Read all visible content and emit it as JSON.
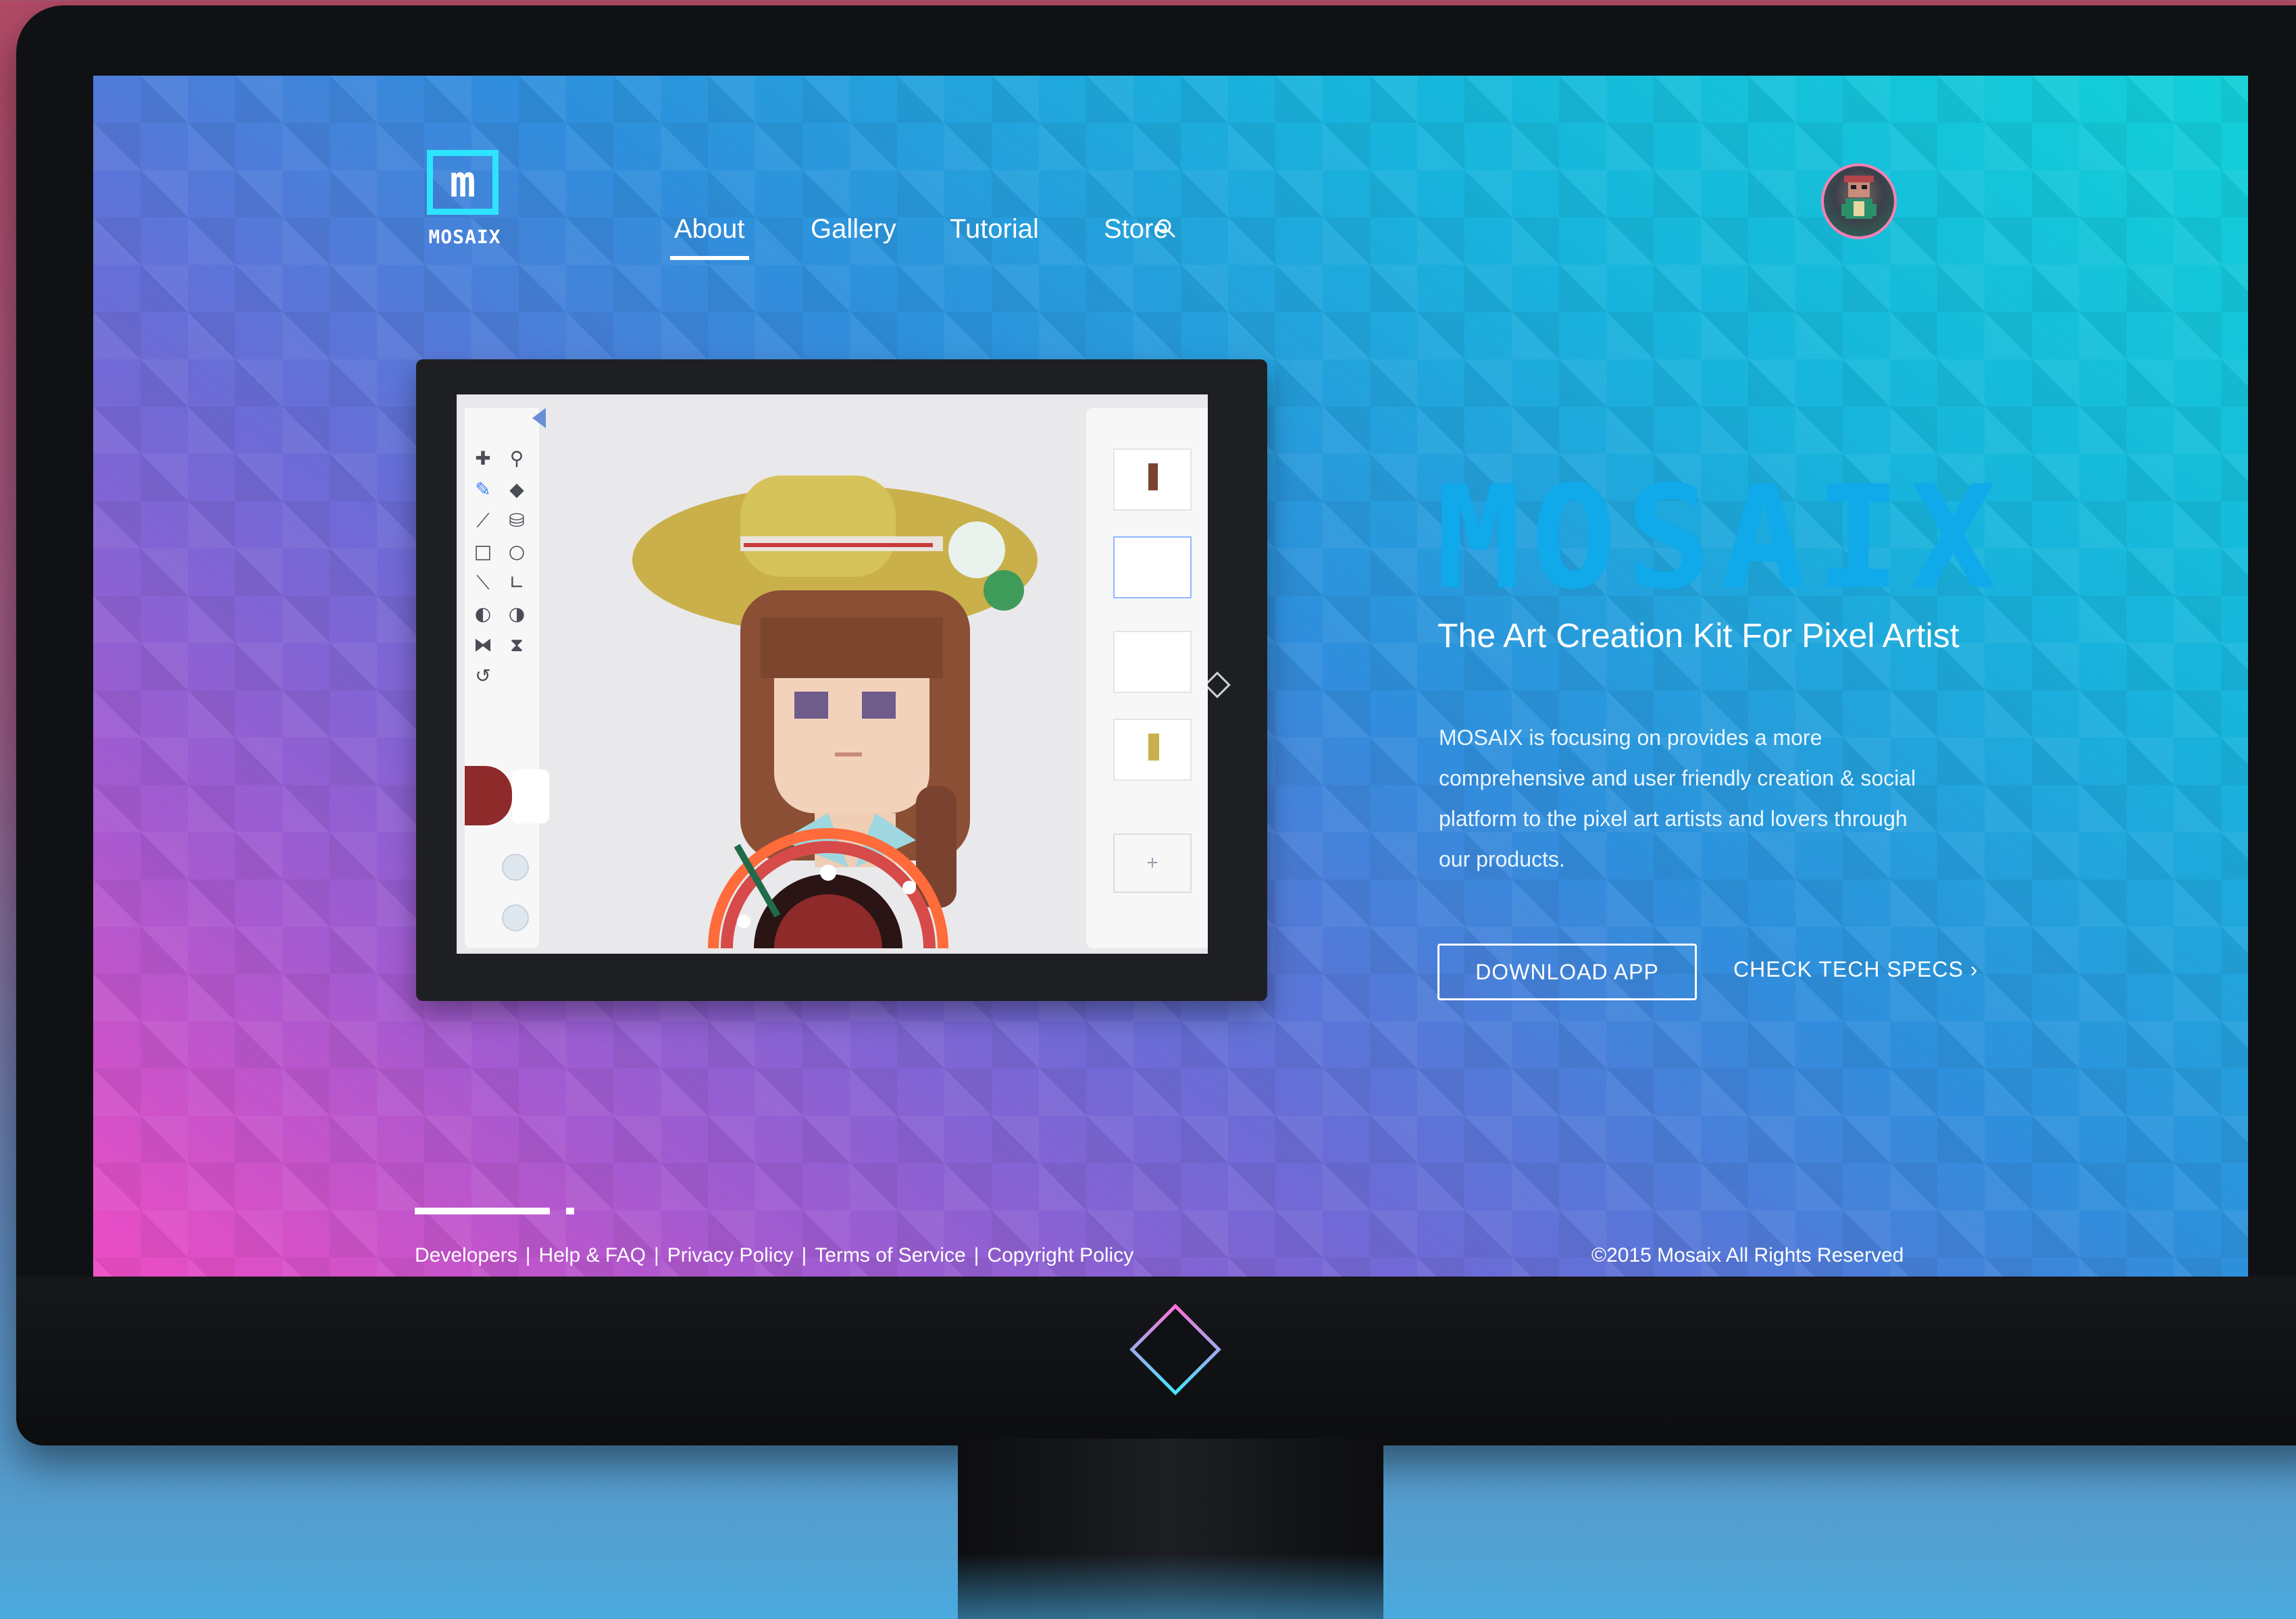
{
  "brand": {
    "logo_mark": "m",
    "logo_text": "MOSAIX",
    "name": "MOSAIX"
  },
  "nav": {
    "items": [
      {
        "label": "About",
        "active": true
      },
      {
        "label": "Gallery",
        "active": false
      },
      {
        "label": "Tutorial",
        "active": false
      },
      {
        "label": "Store",
        "active": false
      }
    ],
    "search_icon": "search-icon"
  },
  "hero": {
    "tagline": "The Art Creation Kit For Pixel Artist",
    "description": "MOSAIX is focusing on provides a more comprehensive and user friendly creation & social platform to the pixel art artists and lovers through our products.",
    "primary_button": "DOWNLOAD APP",
    "secondary_link": "CHECK TECH SPECS ›"
  },
  "app_mock": {
    "add_layer": "+"
  },
  "footer": {
    "links": [
      "Developers",
      "Help & FAQ",
      "Privacy Policy",
      "Terms of Service",
      "Copyright Policy"
    ],
    "separator": "|",
    "copyright": "©2015 Mosaix All Rights Reserved"
  },
  "colors": {
    "accent": "#2de4ff",
    "brand_blue": "#10a9ea",
    "swatch_primary": "#8e2a2a"
  }
}
